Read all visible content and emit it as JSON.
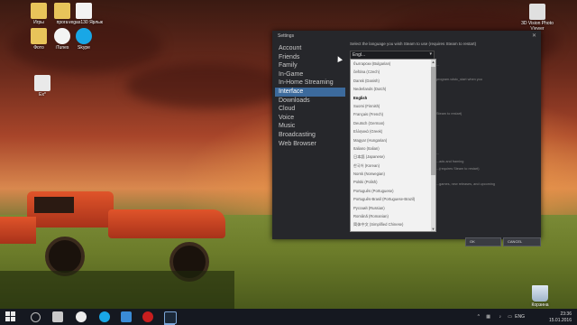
{
  "desktop": {
    "icons_top_left": [
      {
        "label": "Игры",
        "icon": "folder-icon",
        "color": "#e8c45a"
      },
      {
        "label": "прога",
        "icon": "folder-icon",
        "color": "#e8c45a"
      },
      {
        "label": "vegas130 Ярлык",
        "icon": "document-icon",
        "color": "#f3f3f3"
      },
      {
        "label": "Фото",
        "icon": "folder-icon",
        "color": "#e8c45a"
      },
      {
        "label": "iTunes",
        "icon": "music-icon",
        "color": "#f3f3f3"
      },
      {
        "label": "Skype",
        "icon": "skype-icon",
        "color": "#19a7e6"
      }
    ],
    "icon_excel": {
      "label": "Ex*",
      "icon": "spreadsheet-icon"
    },
    "icon_photo_viewer": {
      "label": "3D Vision Photo Viewer",
      "icon": "photo-viewer-icon"
    },
    "icon_recycle": {
      "label": "Корзина",
      "icon": "recycle-bin-icon"
    }
  },
  "settings": {
    "title": "Settings",
    "close": "✕",
    "nav": [
      {
        "label": "Account",
        "active": false
      },
      {
        "label": "Friends",
        "active": false
      },
      {
        "label": "Family",
        "active": false
      },
      {
        "label": "In-Game",
        "active": false
      },
      {
        "label": "In-Home Streaming",
        "active": false
      },
      {
        "label": "Interface",
        "active": true
      },
      {
        "label": "Downloads",
        "active": false
      },
      {
        "label": "Cloud",
        "active": false
      },
      {
        "label": "Voice",
        "active": false
      },
      {
        "label": "Music",
        "active": false
      },
      {
        "label": "Broadcasting",
        "active": false
      },
      {
        "label": "Web Browser",
        "active": false
      }
    ],
    "instruction": "Select the language you wish Steam to use (requires Steam to restart)",
    "selected_language": "Engl...",
    "language_options": [
      "български (Bulgarian)",
      "čeština (Czech)",
      "Dansk (Danish)",
      "Nederlands (Dutch)",
      "English",
      "Suomi (Finnish)",
      "Français (French)",
      "Deutsch (German)",
      "Ελληνικά (Greek)",
      "Magyar (Hungarian)",
      "Italiano (Italian)",
      "日本語 (Japanese)",
      "한국어 (Korean)",
      "Norsk (Norwegian)",
      "Polski (Polish)",
      "Português (Portuguese)",
      "Português-Brasil (Portuguese-Brazil)",
      "Русский (Russian)",
      "Română (Romanian)",
      "简体中文 (Simplified Chinese)"
    ],
    "current_language": "English",
    "background_texts": [
      "...",
      "program.vdstc_start when you",
      "Steam to restart)",
      "...",
      "...ads and framing",
      "...(requires Steam to restart)",
      "...games, new releases, and upcoming"
    ],
    "ok_label": "OK",
    "cancel_label": "CANCEL"
  },
  "taskbar": {
    "apps": [
      "windows-start-icon",
      "search-icon",
      "winamp-icon",
      "yandex-browser-icon",
      "skype-icon",
      "utility-icon",
      "record-icon",
      "steam-icon"
    ],
    "lang": "ENG",
    "time": "23:36",
    "date": "15.01.2016"
  },
  "colors": {
    "accent": "#3c6a9c",
    "dialog_bg": "#26272b"
  }
}
